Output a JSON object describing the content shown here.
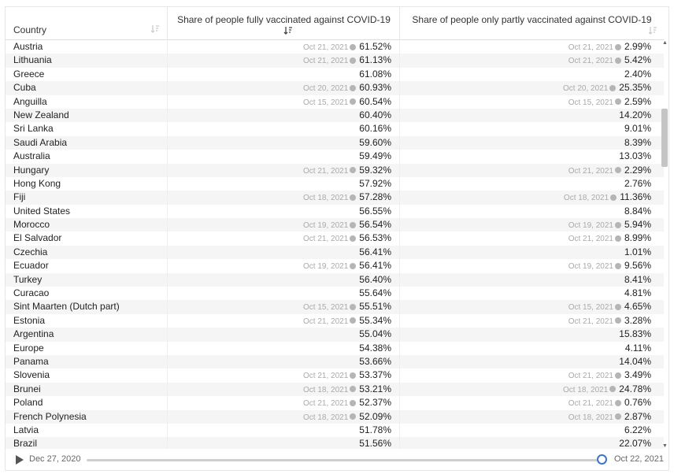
{
  "table": {
    "headers": {
      "country": "Country",
      "full": "Share of people fully vaccinated against COVID-19",
      "partial": "Share of people only partly vaccinated against COVID-19"
    },
    "rows": [
      {
        "country": "Austria",
        "full_date": "Oct 21, 2021",
        "full": "61.52%",
        "partial_date": "Oct 21, 2021",
        "partial": "2.99%"
      },
      {
        "country": "Lithuania",
        "full_date": "Oct 21, 2021",
        "full": "61.13%",
        "partial_date": "Oct 21, 2021",
        "partial": "5.42%"
      },
      {
        "country": "Greece",
        "full_date": "",
        "full": "61.08%",
        "partial_date": "",
        "partial": "2.40%"
      },
      {
        "country": "Cuba",
        "full_date": "Oct 20, 2021",
        "full": "60.93%",
        "partial_date": "Oct 20, 2021",
        "partial": "25.35%"
      },
      {
        "country": "Anguilla",
        "full_date": "Oct 15, 2021",
        "full": "60.54%",
        "partial_date": "Oct 15, 2021",
        "partial": "2.59%"
      },
      {
        "country": "New Zealand",
        "full_date": "",
        "full": "60.40%",
        "partial_date": "",
        "partial": "14.20%"
      },
      {
        "country": "Sri Lanka",
        "full_date": "",
        "full": "60.16%",
        "partial_date": "",
        "partial": "9.01%"
      },
      {
        "country": "Saudi Arabia",
        "full_date": "",
        "full": "59.60%",
        "partial_date": "",
        "partial": "8.39%"
      },
      {
        "country": "Australia",
        "full_date": "",
        "full": "59.49%",
        "partial_date": "",
        "partial": "13.03%"
      },
      {
        "country": "Hungary",
        "full_date": "Oct 21, 2021",
        "full": "59.32%",
        "partial_date": "Oct 21, 2021",
        "partial": "2.29%"
      },
      {
        "country": "Hong Kong",
        "full_date": "",
        "full": "57.92%",
        "partial_date": "",
        "partial": "2.76%"
      },
      {
        "country": "Fiji",
        "full_date": "Oct 18, 2021",
        "full": "57.28%",
        "partial_date": "Oct 18, 2021",
        "partial": "11.36%"
      },
      {
        "country": "United States",
        "full_date": "",
        "full": "56.55%",
        "partial_date": "",
        "partial": "8.84%"
      },
      {
        "country": "Morocco",
        "full_date": "Oct 19, 2021",
        "full": "56.54%",
        "partial_date": "Oct 19, 2021",
        "partial": "5.94%"
      },
      {
        "country": "El Salvador",
        "full_date": "Oct 21, 2021",
        "full": "56.53%",
        "partial_date": "Oct 21, 2021",
        "partial": "8.99%"
      },
      {
        "country": "Czechia",
        "full_date": "",
        "full": "56.41%",
        "partial_date": "",
        "partial": "1.01%"
      },
      {
        "country": "Ecuador",
        "full_date": "Oct 19, 2021",
        "full": "56.41%",
        "partial_date": "Oct 19, 2021",
        "partial": "9.56%"
      },
      {
        "country": "Turkey",
        "full_date": "",
        "full": "56.40%",
        "partial_date": "",
        "partial": "8.41%"
      },
      {
        "country": "Curacao",
        "full_date": "",
        "full": "55.64%",
        "partial_date": "",
        "partial": "4.81%"
      },
      {
        "country": "Sint Maarten (Dutch part)",
        "full_date": "Oct 15, 2021",
        "full": "55.51%",
        "partial_date": "Oct 15, 2021",
        "partial": "4.65%"
      },
      {
        "country": "Estonia",
        "full_date": "Oct 21, 2021",
        "full": "55.34%",
        "partial_date": "Oct 21, 2021",
        "partial": "3.28%"
      },
      {
        "country": "Argentina",
        "full_date": "",
        "full": "55.04%",
        "partial_date": "",
        "partial": "15.83%"
      },
      {
        "country": "Europe",
        "full_date": "",
        "full": "54.38%",
        "partial_date": "",
        "partial": "4.11%"
      },
      {
        "country": "Panama",
        "full_date": "",
        "full": "53.66%",
        "partial_date": "",
        "partial": "14.04%"
      },
      {
        "country": "Slovenia",
        "full_date": "Oct 21, 2021",
        "full": "53.37%",
        "partial_date": "Oct 21, 2021",
        "partial": "3.49%"
      },
      {
        "country": "Brunei",
        "full_date": "Oct 18, 2021",
        "full": "53.21%",
        "partial_date": "Oct 18, 2021",
        "partial": "24.78%"
      },
      {
        "country": "Poland",
        "full_date": "Oct 21, 2021",
        "full": "52.37%",
        "partial_date": "Oct 21, 2021",
        "partial": "0.76%"
      },
      {
        "country": "French Polynesia",
        "full_date": "Oct 18, 2021",
        "full": "52.09%",
        "partial_date": "Oct 18, 2021",
        "partial": "2.87%"
      },
      {
        "country": "Latvia",
        "full_date": "",
        "full": "51.78%",
        "partial_date": "",
        "partial": "6.22%"
      },
      {
        "country": "Brazil",
        "full_date": "",
        "full": "51.56%",
        "partial_date": "",
        "partial": "22.07%"
      }
    ]
  },
  "timeline": {
    "start": "Dec 27, 2020",
    "end": "Oct 22, 2021",
    "position": 1.0
  },
  "colors": {
    "accent": "#3d73c9",
    "row_stripe": "#f5f5f5",
    "muted_text": "#aaaaaa"
  },
  "icons": {
    "play": "play-icon",
    "sort_country": "sort-icon",
    "sort_full": "sort-descending-icon",
    "sort_partial": "sort-icon",
    "info": "info-icon"
  }
}
